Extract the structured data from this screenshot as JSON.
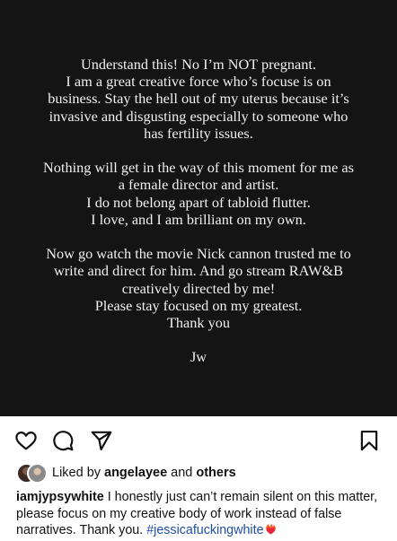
{
  "post": {
    "statement_paragraphs": [
      "Understand this! No I’m NOT pregnant.\nI am a great creative force who’s focuse is on\nbusiness. Stay the hell out of my uterus because it’s\ninvasive and disgusting especially to someone who\nhas fertility issues.",
      "Nothing will get in the way of this moment for me as\na female director and artist.\nI do not belong apart of tabloid flutter.\nI love, and I am brilliant on my own.",
      "Now go watch the movie Nick cannon trusted me to\nwrite and direct for him. And go stream RAW&B\ncreatively directed by me!\nPlease stay focused on my greatest.\nThank you"
    ],
    "signature": "Jw",
    "background_color": "#141414"
  },
  "actions": {
    "like_icon": "heart-outline-icon",
    "comment_icon": "comment-icon",
    "share_icon": "paper-plane-icon",
    "save_icon": "bookmark-icon"
  },
  "likes": {
    "prefix": "Liked by",
    "user": "angelayee",
    "conjunction": "and",
    "others": "others"
  },
  "caption": {
    "username": "iamjypsywhite",
    "text": "I honestly just can’t remain silent on this matter, please focus on my creative body of work instead of false narratives. Thank you.",
    "hashtag": "#jessicafuckingwhite",
    "emoji_icon": "heart-on-fire-icon",
    "hashtag_color": "#1f4fa3"
  }
}
